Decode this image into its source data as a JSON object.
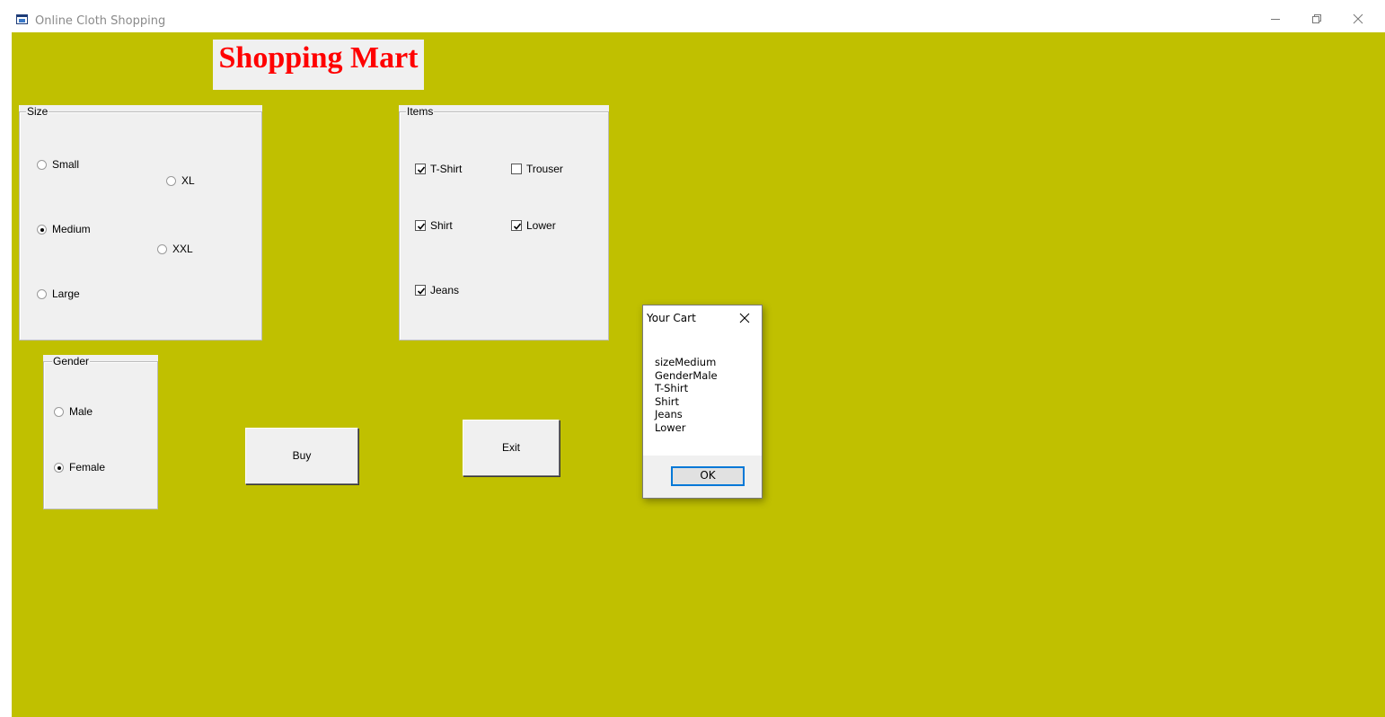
{
  "window": {
    "title": "Online Cloth Shopping",
    "background": "#c0c000"
  },
  "banner": {
    "text": "Shopping Mart",
    "color": "#ff0000"
  },
  "size_group": {
    "legend": "Size",
    "options": [
      {
        "label": "Small",
        "selected": false
      },
      {
        "label": "XL",
        "selected": false
      },
      {
        "label": "Medium",
        "selected": true
      },
      {
        "label": "XXL",
        "selected": false
      },
      {
        "label": "Large",
        "selected": false
      }
    ]
  },
  "items_group": {
    "legend": "Items",
    "options": [
      {
        "label": "T-Shirt",
        "checked": true
      },
      {
        "label": "Trouser",
        "checked": false
      },
      {
        "label": "Shirt",
        "checked": true
      },
      {
        "label": "Lower",
        "checked": true
      },
      {
        "label": "Jeans",
        "checked": true
      }
    ]
  },
  "gender_group": {
    "legend": "Gender",
    "options": [
      {
        "label": "Male",
        "selected": false
      },
      {
        "label": "Female",
        "selected": true
      }
    ]
  },
  "buttons": {
    "buy": "Buy",
    "exit": "Exit"
  },
  "dialog": {
    "title": "Your Cart",
    "lines": [
      "sizeMedium",
      "GenderMale",
      "T-Shirt",
      "Shirt",
      "Jeans",
      "Lower"
    ],
    "ok": "OK"
  }
}
